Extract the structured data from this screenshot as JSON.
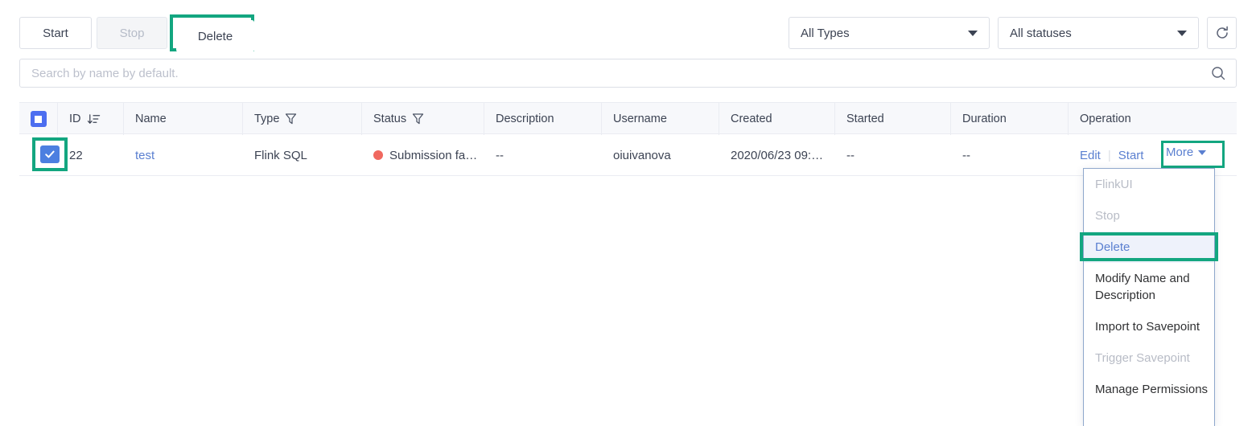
{
  "toolbar": {
    "start_label": "Start",
    "stop_label": "Stop",
    "delete_label": "Delete",
    "type_filter_value": "All Types",
    "status_filter_value": "All statuses",
    "refresh_icon": "refresh-icon"
  },
  "search": {
    "value": "",
    "placeholder": "Search by name by default.",
    "icon": "search-icon"
  },
  "table": {
    "columns": [
      {
        "key": "select",
        "label": "",
        "icon": "checkbox-indeterminate-icon"
      },
      {
        "key": "id",
        "label": "ID",
        "icon": "sort-descending-icon"
      },
      {
        "key": "name",
        "label": "Name",
        "icon": ""
      },
      {
        "key": "type",
        "label": "Type",
        "icon": "filter-icon"
      },
      {
        "key": "status",
        "label": "Status",
        "icon": "filter-icon"
      },
      {
        "key": "description",
        "label": "Description",
        "icon": ""
      },
      {
        "key": "username",
        "label": "Username",
        "icon": ""
      },
      {
        "key": "created",
        "label": "Created",
        "icon": ""
      },
      {
        "key": "started",
        "label": "Started",
        "icon": ""
      },
      {
        "key": "duration",
        "label": "Duration",
        "icon": ""
      },
      {
        "key": "operation",
        "label": "Operation",
        "icon": ""
      }
    ],
    "rows": [
      {
        "selected": true,
        "id": "22",
        "name": "test",
        "type": "Flink SQL",
        "status": "Submission fa…",
        "status_color": "#f0685f",
        "description": "--",
        "username": "oiuivanova",
        "created": "2020/06/23 09:…",
        "started": "--",
        "duration": "--",
        "operations": {
          "edit_label": "Edit",
          "start_label": "Start",
          "more_label": "More"
        }
      }
    ]
  },
  "dropdown": {
    "items": [
      {
        "label": "FlinkUI",
        "state": "disabled"
      },
      {
        "label": "Stop",
        "state": "disabled"
      },
      {
        "label": "Delete",
        "state": "highlighted"
      },
      {
        "label": "Modify Name and Description",
        "state": "normal"
      },
      {
        "label": "Import to Savepoint",
        "state": "normal"
      },
      {
        "label": "Trigger Savepoint",
        "state": "disabled"
      },
      {
        "label": "Manage Permissions",
        "state": "normal"
      }
    ]
  },
  "colors": {
    "highlight": "#13a680",
    "link": "#5a7fd0",
    "checkbox": "#4c6ef0",
    "status_error": "#f0685f"
  }
}
